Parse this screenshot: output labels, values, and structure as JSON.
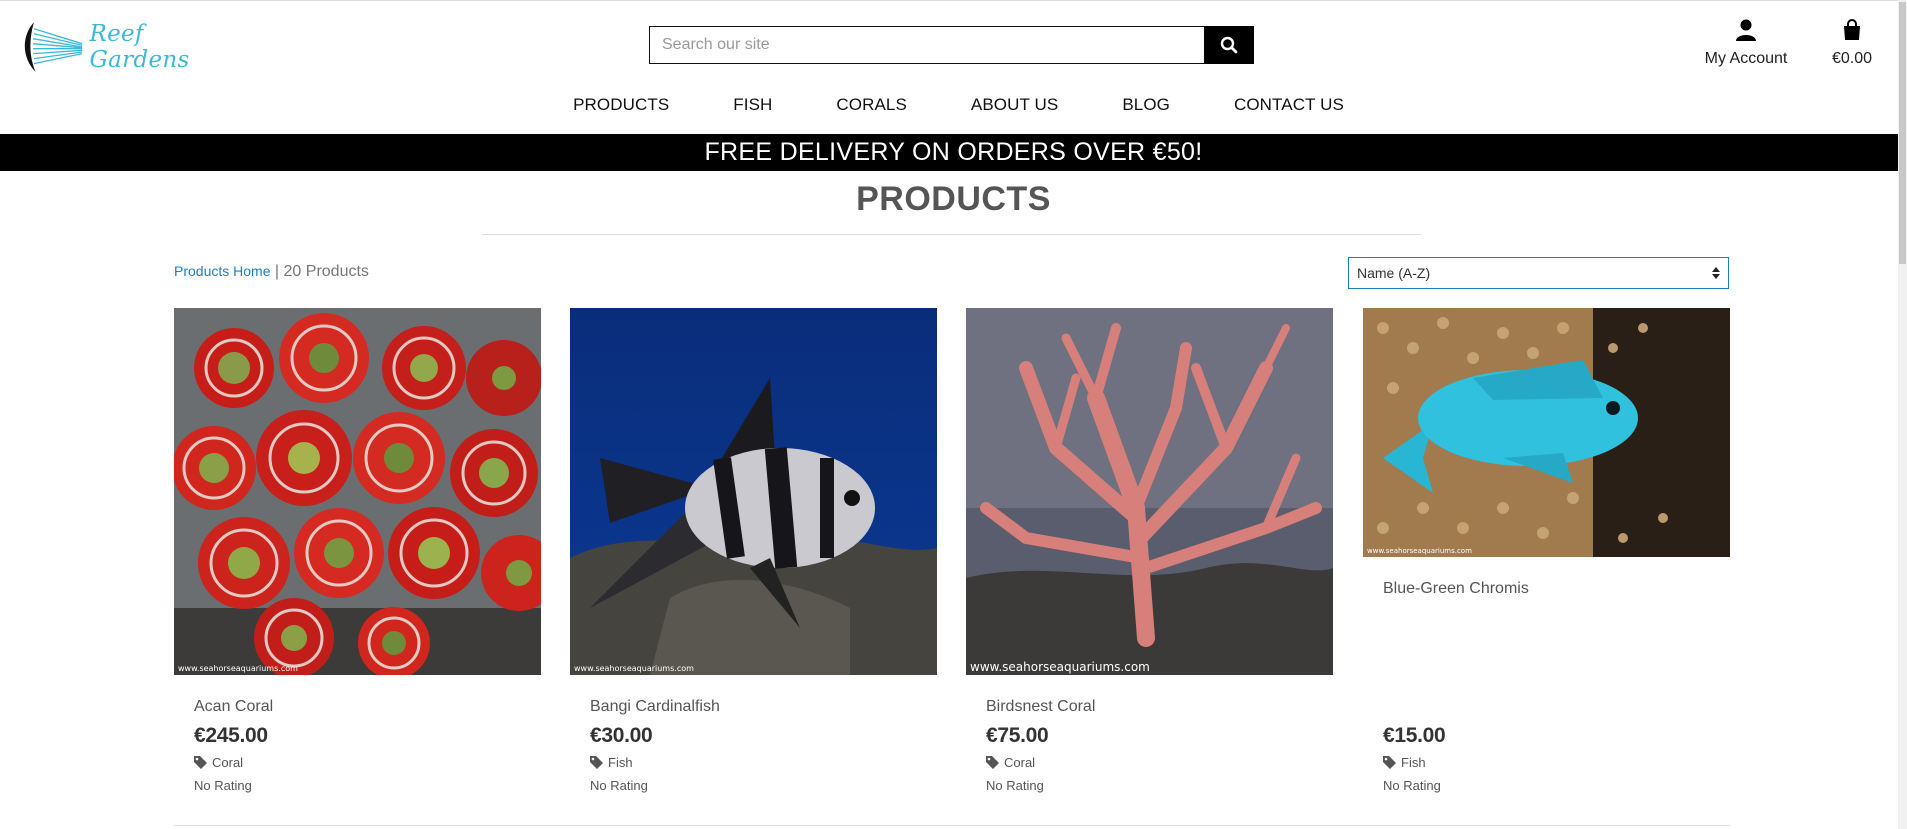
{
  "brand": {
    "name": "Reef Gardens",
    "accent": "#3bb9d9"
  },
  "search": {
    "placeholder": "Search our site",
    "icon": "search-icon"
  },
  "header": {
    "account_label": "My Account",
    "bag_total": "€0.00"
  },
  "nav": {
    "items": [
      "PRODUCTS",
      "FISH",
      "CORALS",
      "ABOUT US",
      "BLOG",
      "CONTACT US"
    ]
  },
  "banner": {
    "text": "FREE DELIVERY ON ORDERS OVER €50!"
  },
  "page": {
    "title": "PRODUCTS",
    "breadcrumb_link": "Products Home",
    "separator": " | ",
    "count": "20 Products"
  },
  "sort": {
    "selected": "Name (A-Z)"
  },
  "products": [
    {
      "name": "Acan Coral",
      "price": "€245.00",
      "category": "Coral",
      "rating": "No Rating",
      "watermark": "www.seahorseaquariums.com"
    },
    {
      "name": "Bangi Cardinalfish",
      "price": "€30.00",
      "category": "Fish",
      "rating": "No Rating",
      "watermark": "www.seahorseaquariums.com"
    },
    {
      "name": "Birdsnest Coral",
      "price": "€75.00",
      "category": "Coral",
      "rating": "No Rating",
      "watermark": "www.seahorseaquariums.com"
    },
    {
      "name": "Blue-Green Chromis",
      "price": "€15.00",
      "category": "Fish",
      "rating": "No Rating",
      "watermark": "www.seahorseaquariums.com"
    }
  ]
}
